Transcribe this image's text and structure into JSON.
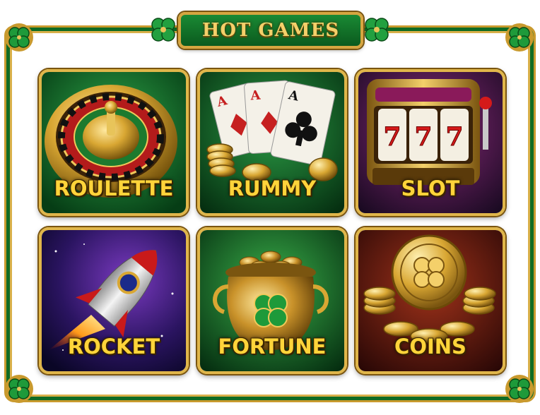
{
  "header": {
    "title": "HOT GAMES"
  },
  "games": [
    {
      "label": "ROULETTE",
      "icon": "roulette-wheel-icon"
    },
    {
      "label": "RUMMY",
      "icon": "playing-cards-icon"
    },
    {
      "label": "SLOT",
      "icon": "slot-machine-icon"
    },
    {
      "label": "ROCKET",
      "icon": "rocket-icon"
    },
    {
      "label": "FORTUNE",
      "icon": "pot-of-gold-icon"
    },
    {
      "label": "COINS",
      "icon": "gold-coins-icon"
    }
  ],
  "slot_reels": [
    "7",
    "7",
    "7"
  ],
  "card_ranks": [
    "A",
    "A",
    "A"
  ],
  "colors": {
    "gold": "#ffd43a",
    "frame_green": "#0f6b24",
    "border_gold": "#e0b64a"
  }
}
